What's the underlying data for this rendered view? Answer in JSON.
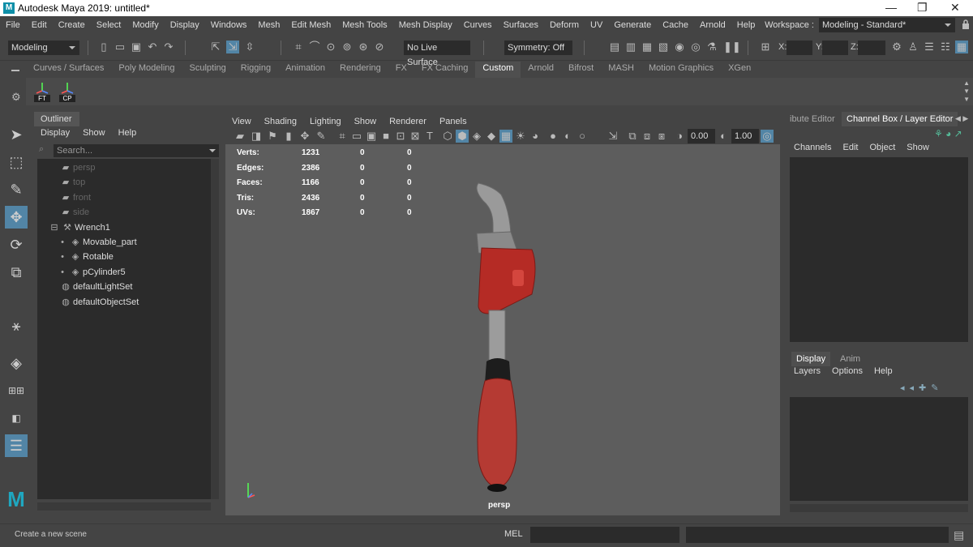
{
  "window": {
    "title": "Autodesk Maya 2019: untitled*",
    "logo": "M",
    "min": "—",
    "max": "❐",
    "close": "✕"
  },
  "menu": [
    "File",
    "Edit",
    "Create",
    "Select",
    "Modify",
    "Display",
    "Windows",
    "Mesh",
    "Edit Mesh",
    "Mesh Tools",
    "Mesh Display",
    "Curves",
    "Surfaces",
    "Deform",
    "UV",
    "Generate",
    "Cache",
    "Arnold",
    "Help"
  ],
  "workspace": {
    "label": "Workspace :",
    "value": "Modeling - Standard*"
  },
  "toolbar": {
    "mode": "Modeling",
    "live_surface": "No Live Surface",
    "symmetry": "Symmetry: Off",
    "x_label": "X:",
    "y_label": "Y:",
    "z_label": "Z:"
  },
  "shelf": {
    "tabs": [
      "Curves / Surfaces",
      "Poly Modeling",
      "Sculpting",
      "Rigging",
      "Animation",
      "Rendering",
      "FX",
      "FX Caching",
      "Custom",
      "Arnold",
      "Bifrost",
      "MASH",
      "Motion Graphics",
      "XGen"
    ],
    "active_tab": "Custom",
    "buttons": [
      "FT",
      "CP"
    ]
  },
  "outliner": {
    "title": "Outliner",
    "menu": [
      "Display",
      "Show",
      "Help"
    ],
    "search_placeholder": "Search...",
    "items": [
      {
        "label": "persp",
        "dim": true
      },
      {
        "label": "top",
        "dim": true
      },
      {
        "label": "front",
        "dim": true
      },
      {
        "label": "side",
        "dim": true
      },
      {
        "label": "Wrench1",
        "dim": false
      },
      {
        "label": "Movable_part",
        "dim": false
      },
      {
        "label": "Rotable",
        "dim": false
      },
      {
        "label": "pCylinder5",
        "dim": false
      },
      {
        "label": "defaultLightSet",
        "dim": false
      },
      {
        "label": "defaultObjectSet",
        "dim": false
      }
    ]
  },
  "viewport": {
    "menu": [
      "View",
      "Shading",
      "Lighting",
      "Show",
      "Renderer",
      "Panels"
    ],
    "field1": "0.00",
    "field2": "1.00",
    "camera": "persp",
    "hud": [
      {
        "label": "Verts:",
        "v1": "1231",
        "v2": "0",
        "v3": "0"
      },
      {
        "label": "Edges:",
        "v1": "2386",
        "v2": "0",
        "v3": "0"
      },
      {
        "label": "Faces:",
        "v1": "1166",
        "v2": "0",
        "v3": "0"
      },
      {
        "label": "Tris:",
        "v1": "2436",
        "v2": "0",
        "v3": "0"
      },
      {
        "label": "UVs:",
        "v1": "1867",
        "v2": "0",
        "v3": "0"
      }
    ]
  },
  "channel_box": {
    "tabs": [
      "ibute Editor",
      "Channel Box / Layer Editor"
    ],
    "menu": [
      "Channels",
      "Edit",
      "Object",
      "Show"
    ]
  },
  "layer_editor": {
    "tabs": [
      "Display",
      "Anim"
    ],
    "menu": [
      "Layers",
      "Options",
      "Help"
    ]
  },
  "status": {
    "help_line": "Create a new scene",
    "mel": "MEL"
  },
  "colors": {
    "panel": "#444444",
    "field": "#2b2b2b",
    "viewport": "#5d5d5d",
    "active_tool": "#5285a6",
    "accent": "#0e8fa8",
    "wrench_red": "#b52b25"
  }
}
